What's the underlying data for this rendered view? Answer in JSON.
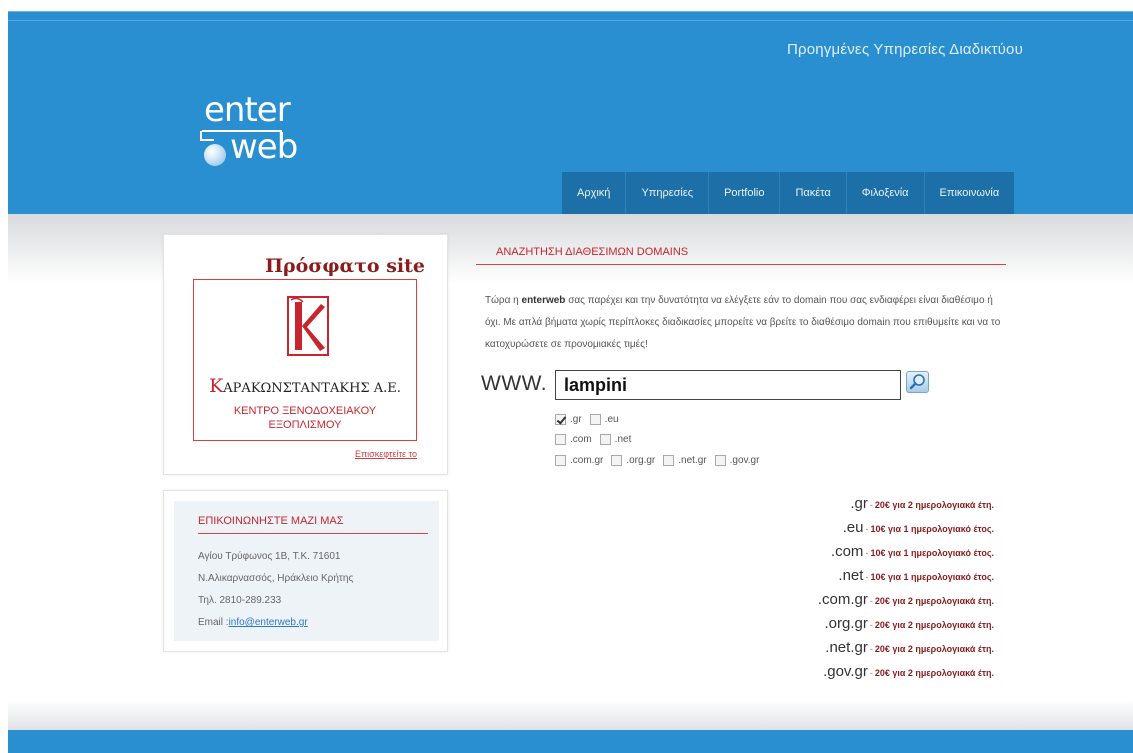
{
  "header": {
    "tagline": "Προηγμένες Υπηρεσίες Διαδικτύου",
    "logo_top": "enter",
    "logo_bottom": "web"
  },
  "nav": {
    "items": [
      {
        "label": "Αρχική"
      },
      {
        "label": "Υπηρεσίες"
      },
      {
        "label": "Portfolio"
      },
      {
        "label": "Πακέτα"
      },
      {
        "label": "Φιλοξενία"
      },
      {
        "label": "Επικοινωνία"
      }
    ]
  },
  "recent": {
    "title": "Πρόσφατο site",
    "client_initial": "K",
    "client_name_rest": "ΑΡΑΚΩΝΣΤΑΝΤΑΚΗΣ Α.Ε.",
    "client_sub1": "ΚΕΝΤΡΟ ΞΕΝΟΔΟΧΕΙΑΚΟΥ",
    "client_sub2": "ΕΞΟΠΛΙΣΜΟΥ",
    "visit_label": "Επισκεφτείτε το"
  },
  "contact": {
    "title": "ΕΠΙΚΟΙΝΩΝΗΣΤΕ ΜΑΖΙ ΜΑΣ",
    "address": "Αγίου Τρύφωνος 1Β, Τ.Κ. 71601",
    "city": "Ν.Αλικαρνασσός, Ηράκλειο Κρήτης",
    "phone": "Τηλ. 2810-289.233",
    "email_label": "Email :",
    "email": "info@enterweb.gr"
  },
  "domains": {
    "section_title": "ΑΝΑΖΗΤΗΣΗ ΔΙΑΘΕΣΙΜΩΝ DOMAINS",
    "intro_pre": "Τώρα η ",
    "intro_brand": "enterweb",
    "intro_post": " σας παρέχει και την δυνατότητα να ελέγξετε εάν το domain που σας ενδιαφέρει είναι διαθέσιμο ή όχι. Με απλά βήματα χωρίς περίπλοκες διαδικασίες μπορείτε να βρείτε το διαθέσιμο domain που επιθυμείτε και να το κατοχυρώσετε σε προνομιακές τιμές!",
    "www_label": "WWW.",
    "search_value": "lampini",
    "tld_rows": [
      [
        {
          "label": ".gr",
          "checked": true
        },
        {
          "label": ".eu",
          "checked": false
        }
      ],
      [
        {
          "label": ".com",
          "checked": false
        },
        {
          "label": ".net",
          "checked": false
        }
      ],
      [
        {
          "label": ".com.gr",
          "checked": false
        },
        {
          "label": ".org.gr",
          "checked": false
        },
        {
          "label": ".net.gr",
          "checked": false
        },
        {
          "label": ".gov.gr",
          "checked": false
        }
      ]
    ],
    "prices": [
      {
        "tld": ".gr",
        "desc": "20€ για 2 ημερολογιακά έτη."
      },
      {
        "tld": ".eu",
        "desc": "10€ για 1 ημερολογιακό έτος."
      },
      {
        "tld": ".com",
        "desc": "10€ για 1 ημερολογιακό έτος."
      },
      {
        "tld": ".net",
        "desc": "10€ για 1 ημερολογιακό έτος."
      },
      {
        "tld": ".com.gr",
        "desc": "20€ για 2 ημερολογιακά έτη."
      },
      {
        "tld": ".org.gr",
        "desc": "20€ για 2 ημερολογιακά έτη."
      },
      {
        "tld": ".net.gr",
        "desc": "20€ για 2 ημερολογιακά έτη."
      },
      {
        "tld": ".gov.gr",
        "desc": "20€ για 2 ημερολογιακά έτη."
      }
    ]
  },
  "colors": {
    "header_blue": "#2a8fd0",
    "nav_blue": "#1d6fa8",
    "accent_red": "#c8262f",
    "price_red": "#8a1c1c"
  }
}
